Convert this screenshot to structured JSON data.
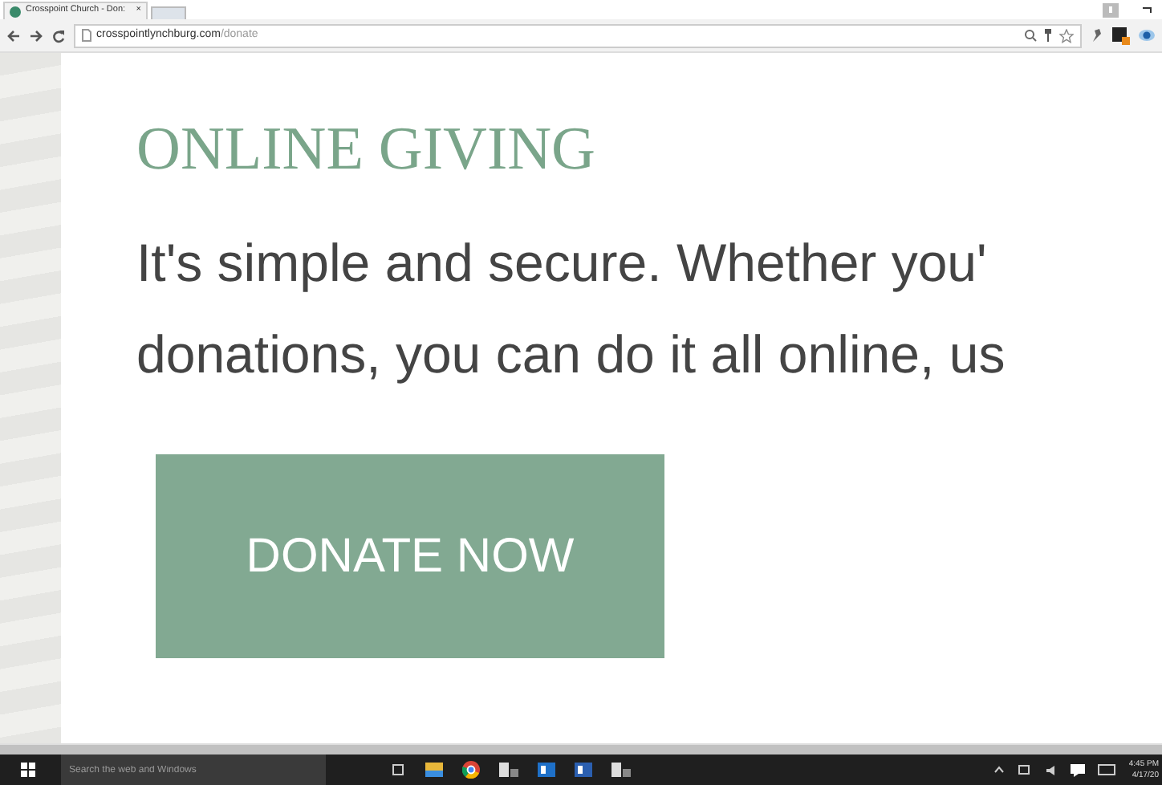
{
  "browser": {
    "tab_title": "Crosspoint Church - Don:",
    "tab_close": "×",
    "url_host": "crosspointlynchburg.com",
    "url_path": "/donate"
  },
  "page": {
    "heading": "ONLINE GIVING",
    "lines": [
      "It's simple and secure. Whether you'",
      "donations, you can do it all online, us"
    ],
    "button": "DONATE NOW"
  },
  "taskbar": {
    "search_placeholder": "Search the web and Windows",
    "time": "4:45 PM",
    "date": "4/17/20"
  }
}
